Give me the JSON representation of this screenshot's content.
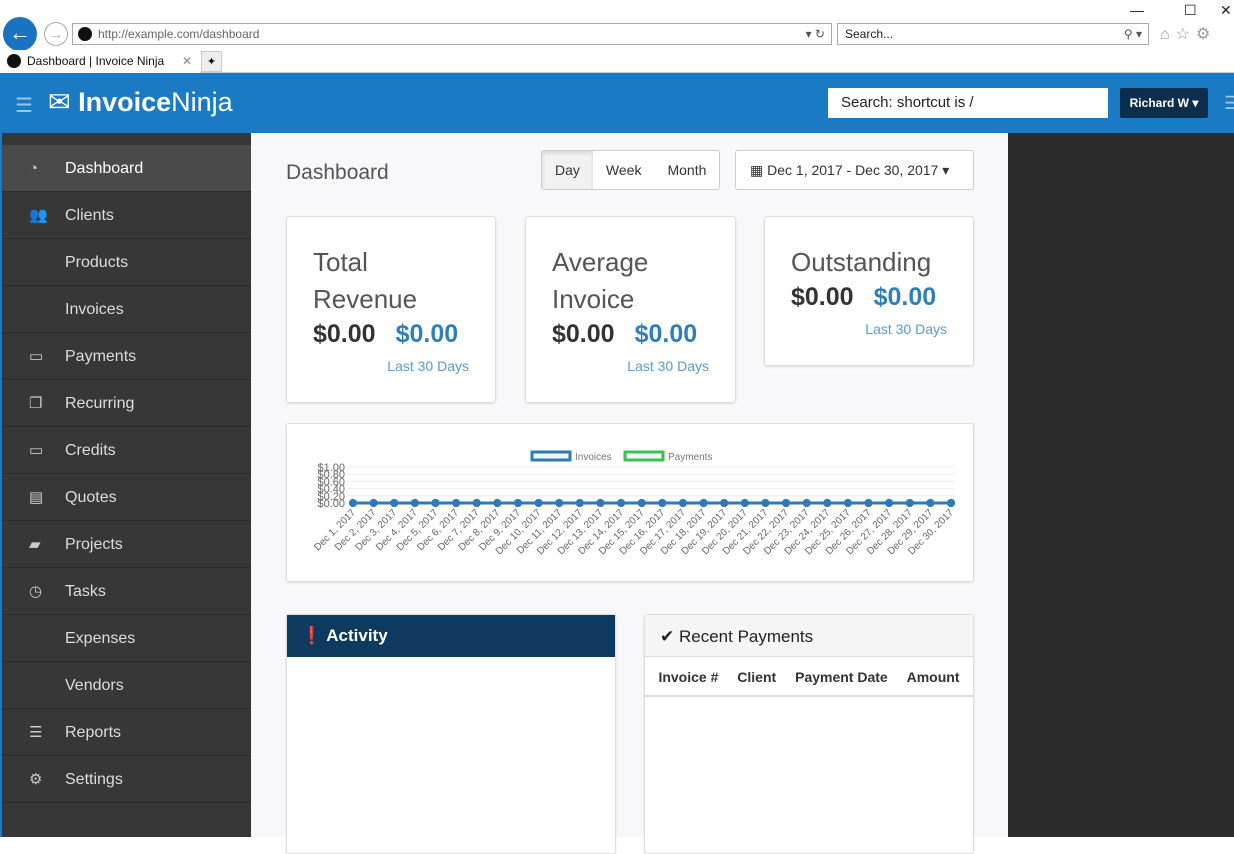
{
  "browser": {
    "url": "http://example.com/dashboard",
    "search_placeholder": "Search...",
    "tab_title": "Dashboard | Invoice Ninja"
  },
  "app": {
    "logo_bold": "Invoice",
    "logo_light": "Ninja",
    "search": "Search: shortcut is /",
    "user": "Richard W ▾"
  },
  "sidebar": {
    "items": [
      {
        "label": "Dashboard",
        "icon": "dashboard-icon",
        "glyph": "◔"
      },
      {
        "label": "Clients",
        "icon": "users-icon",
        "glyph": "👥"
      },
      {
        "label": "Products",
        "icon": "",
        "glyph": ""
      },
      {
        "label": "Invoices",
        "icon": "",
        "glyph": ""
      },
      {
        "label": "Payments",
        "icon": "credit-card-icon",
        "glyph": "▭"
      },
      {
        "label": "Recurring",
        "icon": "files-icon",
        "glyph": "❐"
      },
      {
        "label": "Credits",
        "icon": "credit-card-icon",
        "glyph": "▭"
      },
      {
        "label": "Quotes",
        "icon": "file-icon",
        "glyph": "▤"
      },
      {
        "label": "Projects",
        "icon": "briefcase-icon",
        "glyph": "▰"
      },
      {
        "label": "Tasks",
        "icon": "clock-icon",
        "glyph": "◷"
      },
      {
        "label": "Expenses",
        "icon": "",
        "glyph": ""
      },
      {
        "label": "Vendors",
        "icon": "",
        "glyph": ""
      },
      {
        "label": "Reports",
        "icon": "list-icon",
        "glyph": "☰"
      },
      {
        "label": "Settings",
        "icon": "gear-icon",
        "glyph": "⚙"
      }
    ]
  },
  "dashboard": {
    "title": "Dashboard",
    "periods": [
      "Day",
      "Week",
      "Month"
    ],
    "selected_period": "Day",
    "date_range": "Dec 1, 2017 - Dec 30, 2017 ▾",
    "cards": [
      {
        "title_1": "Total",
        "title_2": "Revenue",
        "amount": "$0.00",
        "amount_alt": "$0.00",
        "sub": "Last 30 Days"
      },
      {
        "title_1": "Average",
        "title_2": "Invoice",
        "amount": "$0.00",
        "amount_alt": "$0.00",
        "sub": "Last 30 Days"
      },
      {
        "title_1": "Outstanding",
        "title_2": "",
        "amount": "$0.00",
        "amount_alt": "$0.00",
        "sub": "Last 30 Days"
      }
    ],
    "activity_title": "Activity",
    "payments_title": "Recent Payments",
    "payment_columns": [
      "Invoice #",
      "Client",
      "Payment Date",
      "Amount"
    ]
  },
  "chart_data": {
    "type": "line",
    "legend_position": "top",
    "grid": true,
    "categories": [
      "Dec 1, 2017",
      "Dec 2, 2017",
      "Dec 3, 2017",
      "Dec 4, 2017",
      "Dec 5, 2017",
      "Dec 6, 2017",
      "Dec 7, 2017",
      "Dec 8, 2017",
      "Dec 9, 2017",
      "Dec 10, 2017",
      "Dec 11, 2017",
      "Dec 12, 2017",
      "Dec 13, 2017",
      "Dec 14, 2017",
      "Dec 15, 2017",
      "Dec 16, 2017",
      "Dec 17, 2017",
      "Dec 18, 2017",
      "Dec 19, 2017",
      "Dec 20, 2017",
      "Dec 21, 2017",
      "Dec 22, 2017",
      "Dec 23, 2017",
      "Dec 24, 2017",
      "Dec 25, 2017",
      "Dec 26, 2017",
      "Dec 27, 2017",
      "Dec 28, 2017",
      "Dec 29, 2017",
      "Dec 30, 2017"
    ],
    "series": [
      {
        "name": "Invoices",
        "color": "#2f7ab4",
        "values": [
          0,
          0,
          0,
          0,
          0,
          0,
          0,
          0,
          0,
          0,
          0,
          0,
          0,
          0,
          0,
          0,
          0,
          0,
          0,
          0,
          0,
          0,
          0,
          0,
          0,
          0,
          0,
          0,
          0,
          0
        ]
      },
      {
        "name": "Payments",
        "color": "#3cbf4e",
        "values": [
          0,
          0,
          0,
          0,
          0,
          0,
          0,
          0,
          0,
          0,
          0,
          0,
          0,
          0,
          0,
          0,
          0,
          0,
          0,
          0,
          0,
          0,
          0,
          0,
          0,
          0,
          0,
          0,
          0,
          0
        ]
      }
    ],
    "yticks": [
      "$0.00",
      "$0.20",
      "$0.40",
      "$0.60",
      "$0.80",
      "$1.00"
    ],
    "ylim": [
      0,
      1
    ]
  }
}
